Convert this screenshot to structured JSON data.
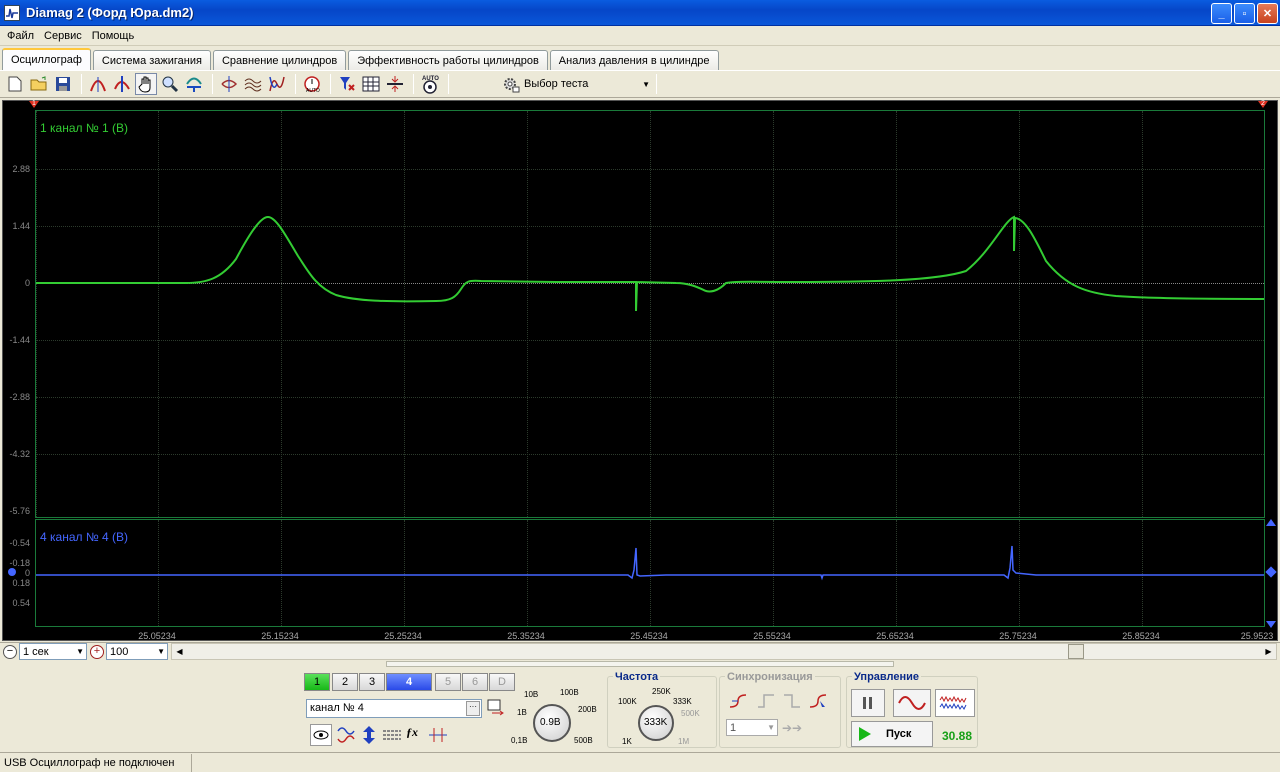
{
  "window": {
    "title": "Diamag 2 (Форд Юра.dm2)"
  },
  "menu": [
    "Файл",
    "Сервис",
    "Помощь"
  ],
  "tabs": [
    {
      "label": "Осциллограф",
      "active": true
    },
    {
      "label": "Система зажигания"
    },
    {
      "label": "Сравнение цилиндров"
    },
    {
      "label": "Эффективность работы цилиндров"
    },
    {
      "label": "Анализ давления в цилиндре"
    }
  ],
  "toolbar": {
    "test_select_label": "Выбор теста",
    "icons": [
      "new-file-icon",
      "open-folder-icon",
      "save-icon",
      "curve-cursor-icon",
      "vertical-measure-icon",
      "hand-pan-icon",
      "zoom-icon",
      "channel-scale-icon",
      "spread-icon",
      "wave-overlay-icon",
      "wave-stack-icon",
      "auto-timebase-icon",
      "filter-icon",
      "grid-icon",
      "horizontal-split-icon",
      "auto-icon"
    ]
  },
  "scope": {
    "channel1": {
      "label": "1 канал № 1 (В)",
      "color": "#33cc33",
      "y_ticks": [
        "2.88",
        "1.44",
        "0",
        "-1.44",
        "-2.88",
        "-4.32",
        "-5.76"
      ]
    },
    "channel4": {
      "label": "4 канал № 4 (В)",
      "color": "#4466ff",
      "y_ticks": [
        "-0.54",
        "-0.18",
        "0",
        "0.18",
        "0.54"
      ]
    },
    "x_ticks": [
      "25.05234",
      "25.15234",
      "25.25234",
      "25.35234",
      "25.45234",
      "25.55234",
      "25.65234",
      "25.75234",
      "25.85234",
      "25.9523"
    ],
    "marker_left": "1",
    "marker_right": "2"
  },
  "timebase": {
    "value": "1 сек"
  },
  "zoom": {
    "value": "100"
  },
  "channels_panel": {
    "buttons": [
      "1",
      "2",
      "3",
      "4",
      "5",
      "6",
      "D"
    ],
    "selected": "4",
    "name_field": "канал № 4",
    "volt_labels": {
      "v10": "10В",
      "v100": "100В",
      "v1": "1В",
      "v200": "200В",
      "v01": "0,1В",
      "v500": "500В"
    },
    "volt_value": "0.9В"
  },
  "frequency": {
    "title": "Частота",
    "labels": {
      "f100k": "100K",
      "f250k": "250K",
      "f333k": "333K",
      "f500k": "500K",
      "f1k": "1K",
      "f1m": "1M"
    },
    "value": "333K"
  },
  "sync": {
    "title": "Синхронизация",
    "channel": "1"
  },
  "control": {
    "title": "Управление",
    "start_label": "Пуск",
    "fps": "30.88"
  },
  "status": {
    "text": "USB Осциллограф не подключен"
  }
}
